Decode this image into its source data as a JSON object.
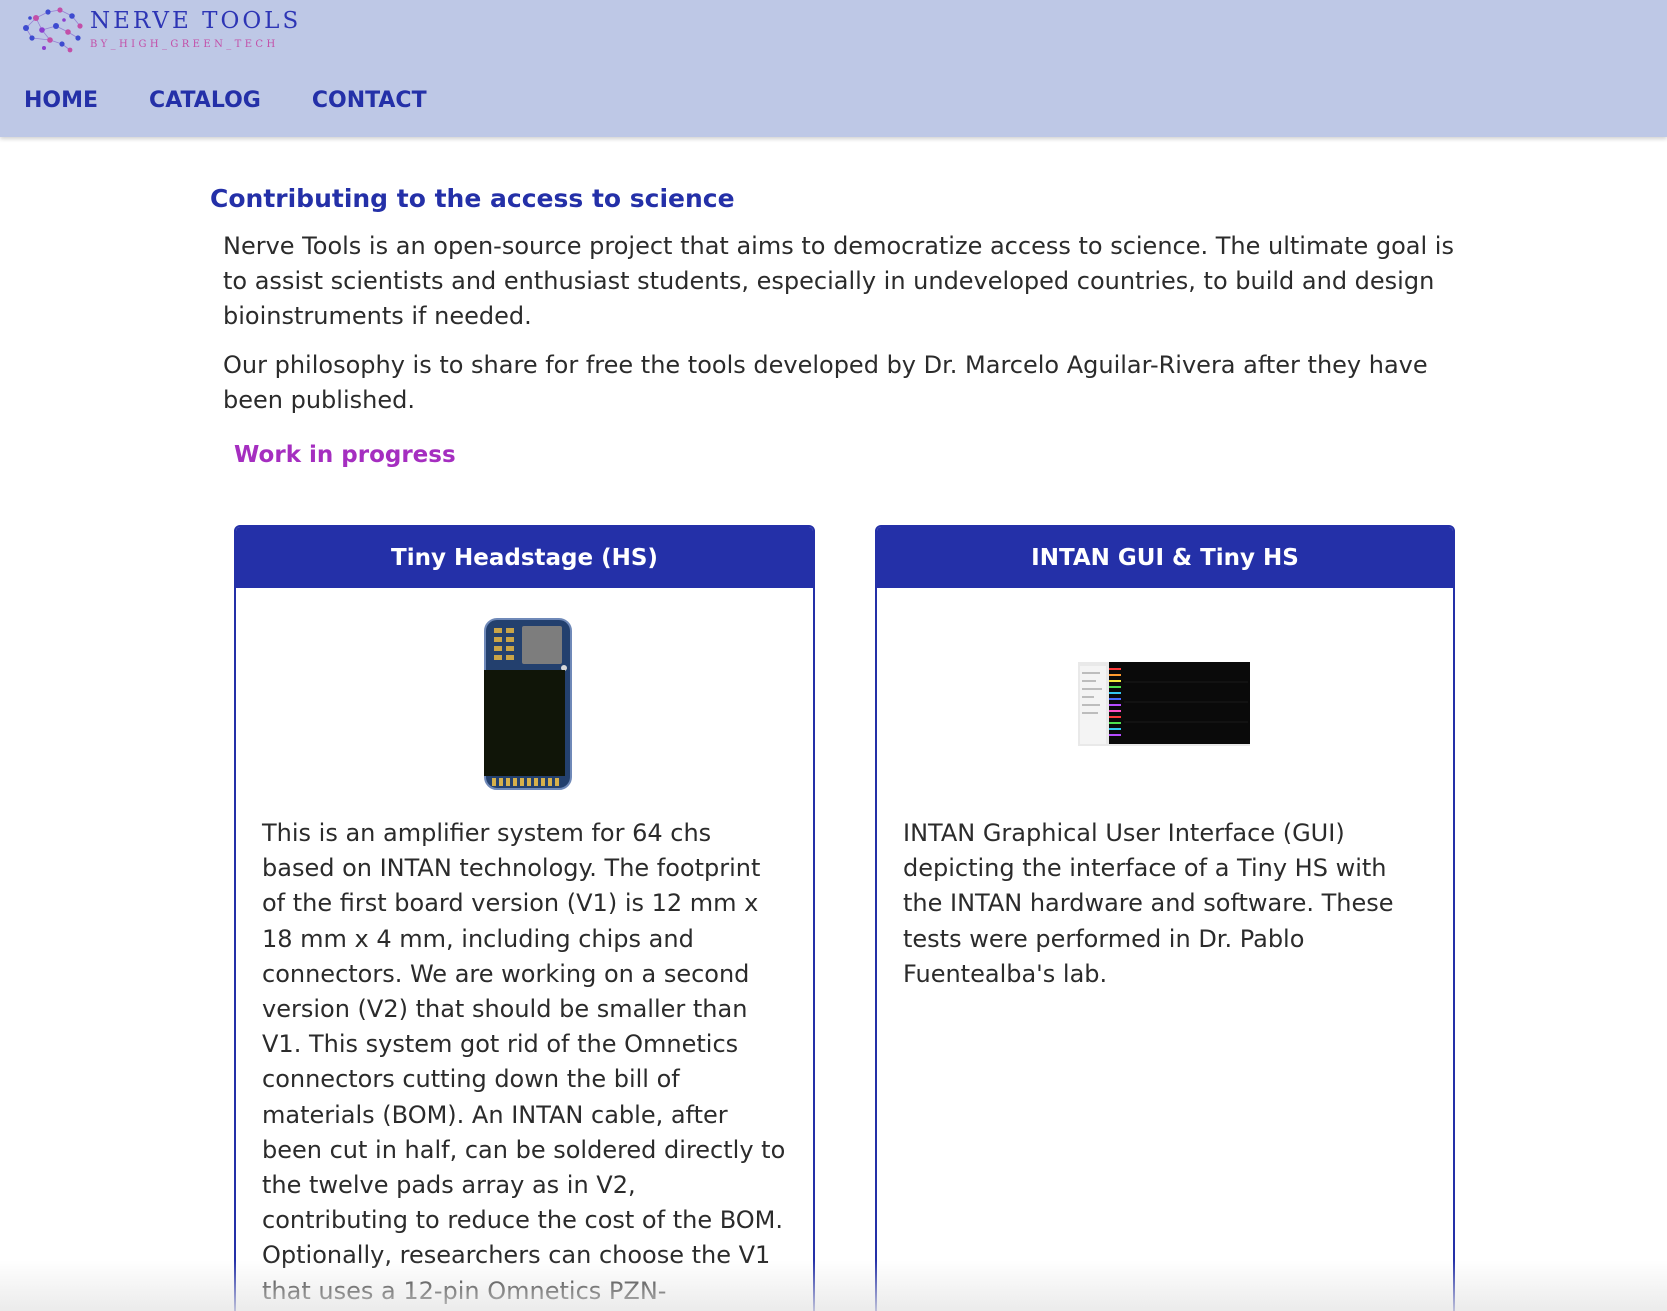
{
  "brand": {
    "name": "NERVE TOOLS",
    "tagline": "BY_HIGH_GREEN_TECH"
  },
  "nav": {
    "items": [
      {
        "label": "HOME"
      },
      {
        "label": "CATALOG"
      },
      {
        "label": "CONTACT"
      }
    ]
  },
  "intro": {
    "heading": "Contributing to the access to science",
    "paragraph1": "Nerve Tools is an open-source project that aims to democratize access to science. The ultimate goal is to assist scientists and enthusiast students, especially in undeveloped countries, to build and design bioinstruments if needed.",
    "paragraph2": "Our philosophy is to share for free the tools developed by Dr. Marcelo Aguilar-Rivera after they have been published."
  },
  "status": {
    "label": "Work in progress"
  },
  "cards": [
    {
      "title": "Tiny Headstage (HS)",
      "description": "This is an amplifier system for 64 chs based on INTAN technology. The footprint of the first board version (V1) is 12 mm x 18 mm x 4 mm, including chips and connectors. We are working on a second version (V2) that should be smaller than V1. This system got rid of the Omnetics connectors cutting down the bill of materials (BOM). An INTAN cable, after been cut in half, can be soldered directly to the twelve pads array as in V2, contributing to reduce the cost of the BOM. Optionally, researchers can choose the V1 that uses a 12-pin Omnetics PZN-"
    },
    {
      "title": "INTAN GUI & Tiny HS",
      "description": "INTAN Graphical User Interface (GUI) depicting the interface of a Tiny HS with the INTAN hardware and software. These tests were performed in Dr. Pablo Fuentealba's lab."
    }
  ],
  "colors": {
    "header_bg": "#bec8e6",
    "brand_blue": "#2430a8",
    "accent_purple": "#a52ec0",
    "text": "#2b2b2b"
  },
  "icons": {
    "logo": "brain-network-logo",
    "card1_image": "headstage-board-image",
    "card2_image": "intan-gui-screenshot-image"
  }
}
